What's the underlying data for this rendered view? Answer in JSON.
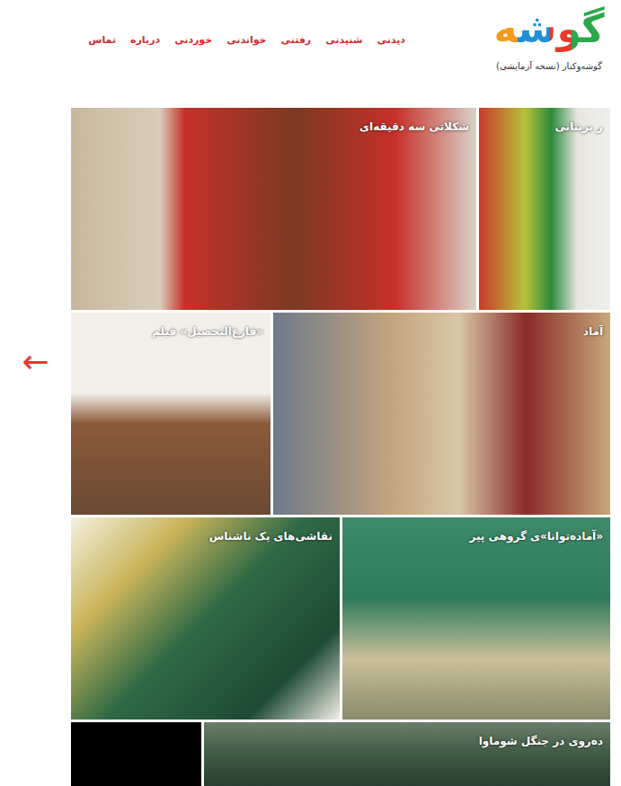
{
  "header": {
    "logo": "گوشه",
    "tagline": "گوشه‌وکنار (نسخه آزمایشی)",
    "nav": [
      "دیدنی",
      "شنیدنی",
      "رفتنی",
      "خواندنی",
      "خوردنی",
      "درباره",
      "تماس"
    ]
  },
  "arrow": "←",
  "rows": [
    [
      {
        "title": "شکلاتی سه دقیقه‌ای"
      },
      {
        "title": "ر بریتانی"
      }
    ],
    [
      {
        "title": "«فارغ‌التحصیل» فیلم"
      },
      {
        "title": "آماد"
      }
    ],
    [
      {
        "title": "نقاشی‌های یک ناشناس"
      },
      {
        "title": "«آماده‌توانا»ی گروهی پیر"
      }
    ],
    [
      {
        "title": ""
      },
      {
        "title": "ده‌روی در جنگل شوماوا"
      }
    ]
  ]
}
